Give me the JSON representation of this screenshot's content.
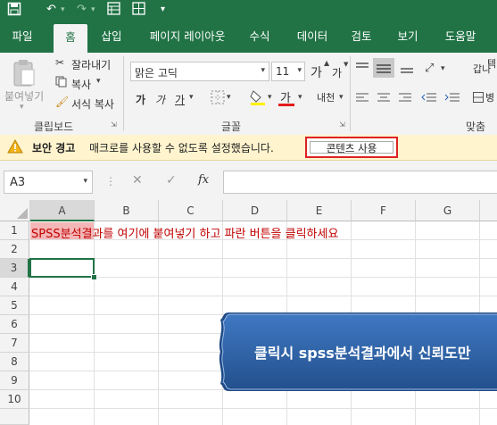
{
  "quick_access": {
    "save_icon": "save-icon",
    "undo_icon": "undo-icon",
    "redo_icon": "redo-icon",
    "form_icon": "form-icon",
    "table_icon": "table-icon",
    "more_icon": "customize-icon"
  },
  "tabs": [
    {
      "label": "파일",
      "active": false
    },
    {
      "label": "홈",
      "active": true
    },
    {
      "label": "삽입",
      "active": false
    },
    {
      "label": "페이지 레이아웃",
      "active": false
    },
    {
      "label": "수식",
      "active": false
    },
    {
      "label": "데이터",
      "active": false
    },
    {
      "label": "검토",
      "active": false
    },
    {
      "label": "보기",
      "active": false
    },
    {
      "label": "도움말",
      "active": false
    }
  ],
  "ribbon": {
    "clipboard": {
      "paste_label": "붙여넣기",
      "cut_label": "잘라내기",
      "copy_label": "복사",
      "format_painter_label": "서식 복사",
      "group_label": "클립보드"
    },
    "font": {
      "font_name": "맑은 고딕",
      "font_size": "11",
      "grow_label": "가",
      "shrink_label": "가",
      "bold_label": "가",
      "italic_label": "가",
      "underline_label": "가",
      "font_color_label": "가",
      "phonetic_label": "내천",
      "group_label": "글꼴"
    },
    "alignment": {
      "wrap_label": "갑나",
      "merge_label": "병",
      "extra_label": "텍",
      "group_label": "맞춤"
    }
  },
  "security_bar": {
    "title": "보안 경고",
    "message": "매크로를 사용할 수 없도록 설정했습니다.",
    "button_label": "콘텐츠 사용"
  },
  "formula_bar": {
    "name_box": "A3",
    "fx_label": "fx",
    "formula_value": ""
  },
  "sheet": {
    "columns": [
      "A",
      "B",
      "C",
      "D",
      "E",
      "F",
      "G"
    ],
    "rows": [
      "1",
      "2",
      "3",
      "4",
      "5",
      "6",
      "7",
      "8",
      "9",
      "10"
    ],
    "selected_cell": "A3",
    "a1_highlight": "SPSS분석",
    "a1_text": "결과를 여기에 붙여넣기 하고 파란 버튼을 클릭하세요",
    "a1_color": "#c00000",
    "a1_fill": "#f4b6b6"
  },
  "callout": {
    "text": "클릭시 spss분석결과에서 신뢰도만"
  },
  "colors": {
    "excel_green": "#217346",
    "callout_blue": "#2e5d9a",
    "warning_red": "#d22222"
  }
}
